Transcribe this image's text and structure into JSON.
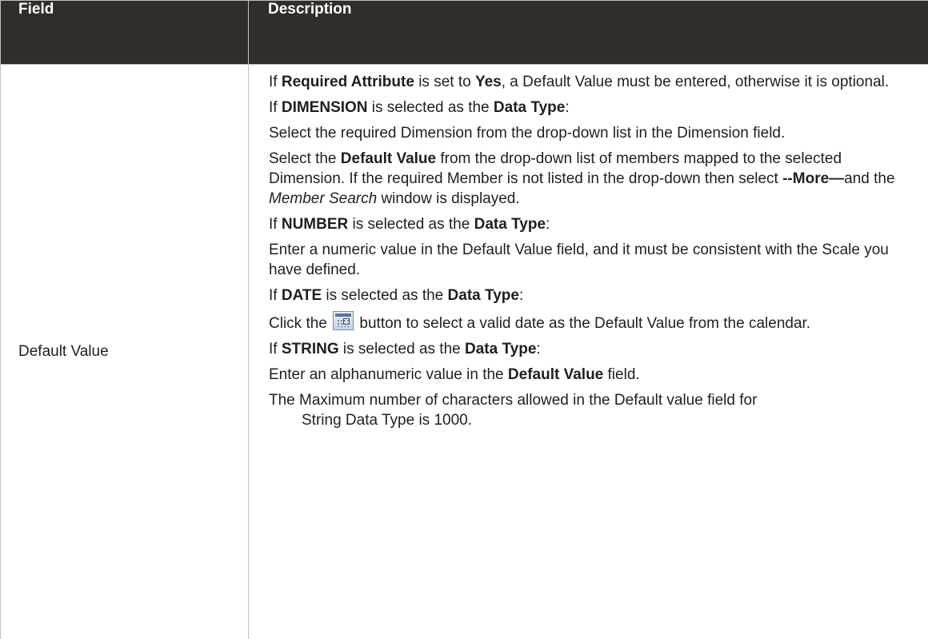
{
  "table": {
    "headers": {
      "field": "Field",
      "description": "Description"
    },
    "row": {
      "field": "Default Value",
      "description": {
        "p1": {
          "a": "If ",
          "b": "Required Attribute",
          "c": " is set to ",
          "d": "Yes",
          "e": ", a Default Value must be entered, otherwise it is optional."
        },
        "p2": {
          "a": "If ",
          "b": "DIMENSION",
          "c": " is selected as the ",
          "d": "Data Type",
          "e": ":"
        },
        "p3": "Select the required Dimension from the drop-down list in the Dimension field.",
        "p4": {
          "a": "Select the ",
          "b": "Default Value",
          "c": " from the drop-down list of members mapped to the selected Dimension. If the required Member is not listed in the drop-down then select ",
          "d": "--More—",
          "e": "and the ",
          "f": "Member Search",
          "g": " window is displayed."
        },
        "p5": {
          "a": "If ",
          "b": "NUMBER",
          "c": " is selected as the ",
          "d": "Data Type",
          "e": ":"
        },
        "p6": "Enter a numeric value in the Default Value field, and it must be consistent with the Scale you have defined.",
        "p7": {
          "a": "If ",
          "b": "DATE",
          "c": " is selected as the ",
          "d": "Data Type",
          "e": ":"
        },
        "p8": {
          "a": "Click the ",
          "icon": "calendar-icon",
          "b": " button to select a valid date as the Default Value from the calendar."
        },
        "p9": {
          "a": "If ",
          "b": "STRING",
          "c": " is selected as the ",
          "d": "Data Type",
          "e": ":"
        },
        "p10": {
          "a": "Enter an alphanumeric value in the ",
          "b": "Default Value",
          "c": " field."
        },
        "p11": "The Maximum number of characters allowed in the Default value field for",
        "p12": "String Data Type is 1000."
      }
    }
  },
  "colors": {
    "header_bg": "#312d2a",
    "header_text": "#ffffff",
    "border": "#bfbfbf"
  }
}
